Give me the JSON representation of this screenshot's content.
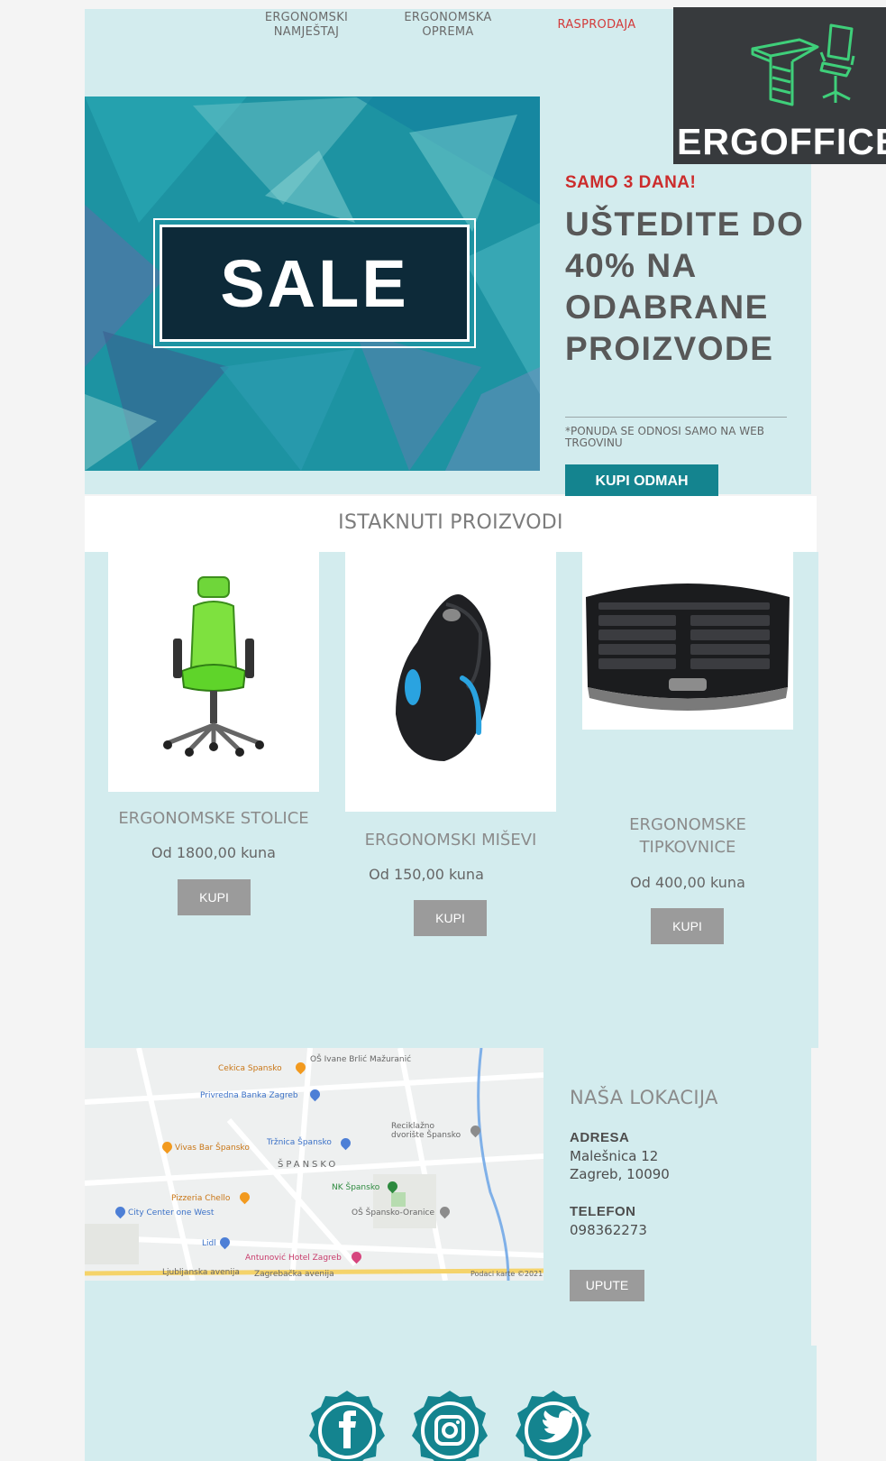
{
  "nav": {
    "items": [
      {
        "label_line1": "ERGONOMSKI",
        "label_line2": "NAMJEŠTAJ"
      },
      {
        "label_line1": "ERGONOMSKA",
        "label_line2": "OPREMA"
      },
      {
        "label_line1": "RASPRODAJA",
        "label_line2": ""
      }
    ]
  },
  "logo": {
    "text": "ERGOFFICE"
  },
  "banner": {
    "sale_text": "SALE"
  },
  "promo": {
    "kicker": "SAMO 3 DANA!",
    "headline": "UŠTEDITE DO 40% NA ODABRANE PROIZVODE",
    "note": "*PONUDA SE ODNOSI SAMO NA WEB TRGOVINU",
    "cta": "KUPI ODMAH"
  },
  "featured": {
    "title": "ISTAKNUTI PROIZVODI",
    "products": [
      {
        "name_line1": "ERGONOMSKE STOLICE",
        "name_line2": "",
        "price": "Od 1800,00 kuna",
        "button": "KUPI"
      },
      {
        "name_line1": "ERGONOMSKI MIŠEVI",
        "name_line2": "",
        "price": "Od 150,00 kuna",
        "button": "KUPI"
      },
      {
        "name_line1": "ERGONOMSKE",
        "name_line2": "TIPKOVNICE",
        "price": "Od 400,00 kuna",
        "button": "KUPI"
      }
    ]
  },
  "map": {
    "labels": [
      "Cekica Spansko",
      "OŠ Ivane Brlić Mažuranić",
      "Privredna Banka Zagreb",
      "Reciklažno dvorište Špansko",
      "Vivas Bar Špansko",
      "Tržnica Špansko",
      "ŠPANSKO",
      "NK Špansko",
      "Pizzeria Chello",
      "City Center one West",
      "OŠ Špansko-Oranice",
      "Lidl",
      "Antunović Hotel Zagreb",
      "Ljubljanska avenija",
      "Zagrebačka avenija",
      "Podaci karte ©2021."
    ]
  },
  "location": {
    "title": "NAŠA LOKACIJA",
    "address_label": "ADRESA",
    "address_line1": "Malešnica 12",
    "address_line2": "Zagreb, 10090",
    "phone_label": "TELEFON",
    "phone": "098362273",
    "button": "UPUTE"
  },
  "social": {
    "icons": [
      "facebook-icon",
      "instagram-icon",
      "twitter-icon"
    ]
  },
  "colors": {
    "panel": "#d3ecee",
    "accent": "#14848f",
    "sale_red": "#cc2c2c",
    "button_grey": "#9b9b9b"
  }
}
